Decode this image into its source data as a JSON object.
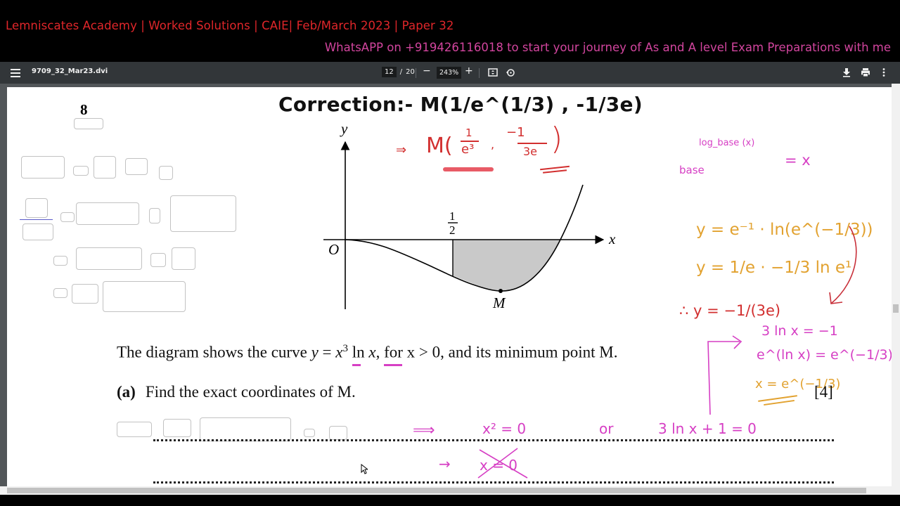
{
  "banner": {
    "line1": "Lemniscates Academy | Worked Solutions | CAIE| Feb/March 2023 | Paper 32",
    "line2": "WhatsAPP on +919426116018 to start your journey of As and A level Exam Preparations with me",
    "line1_color": "#e0262a",
    "line2_color": "#d2459e"
  },
  "toolbar": {
    "menu_icon": "hamburger-menu-icon",
    "file_name": "9709_32_Mar23.dvi",
    "current_page": "12",
    "page_separator": "/",
    "total_pages": "20",
    "zoom_out": "−",
    "zoom_level": "243%",
    "zoom_in": "+",
    "fit_icon": "fit-to-page-icon",
    "rotate_icon": "rotate-icon",
    "download_icon": "download-icon",
    "print_icon": "print-icon",
    "more_icon": "more-vertical-icon"
  },
  "document": {
    "correction_note": "Correction:- M(1/e^(1/3)  , -1/3e)",
    "question_number": "8",
    "diagram": {
      "y_label": "y",
      "x_label": "x",
      "origin_label": "O",
      "half_numerator": "1",
      "half_denominator": "2",
      "min_point_label": "M"
    },
    "question_text_pre": "The diagram shows the curve ",
    "question_eq_y": "y",
    "question_eq_eq": " = ",
    "question_eq_x": "x",
    "question_eq_exp": "3",
    "question_eq_ln": " ln ",
    "question_eq_x2": "x",
    "question_text_post": ", for x > 0, and its minimum point M.",
    "part_a_label": "(a)",
    "part_a_text": "Find the exact coordinates of M.",
    "part_a_marks": "[4]"
  },
  "annotations": {
    "m_handwritten": {
      "arrow": "⇒",
      "text": "M(",
      "x_num": "1",
      "x_den": "e³",
      "comma": ",",
      "y_num": "−1",
      "y_den": "3e",
      "close": ")"
    },
    "log_rule": {
      "exponent": "log_base (x)",
      "base": "base",
      "rhs": "= x"
    },
    "y_steps": [
      "y = e⁻¹ · ln(e^(−1/3))",
      "y = 1/e · −1/3 ln e¹"
    ],
    "y_result": "∴ y = −1/(3e)",
    "x_steps": [
      "3 ln x = −1",
      "e^(ln x) = e^(−1/3)",
      "x = e^(−1/3)"
    ],
    "line1": {
      "arrow": "⟹",
      "eq1": "x² = 0",
      "or": "or",
      "eq2": "3 ln x + 1 = 0"
    },
    "line2": {
      "arrow": "→",
      "crossed": "x = 0"
    },
    "colors": {
      "pink": "#d63fc4",
      "red": "#d22f2f",
      "orange": "#e2a230"
    }
  }
}
